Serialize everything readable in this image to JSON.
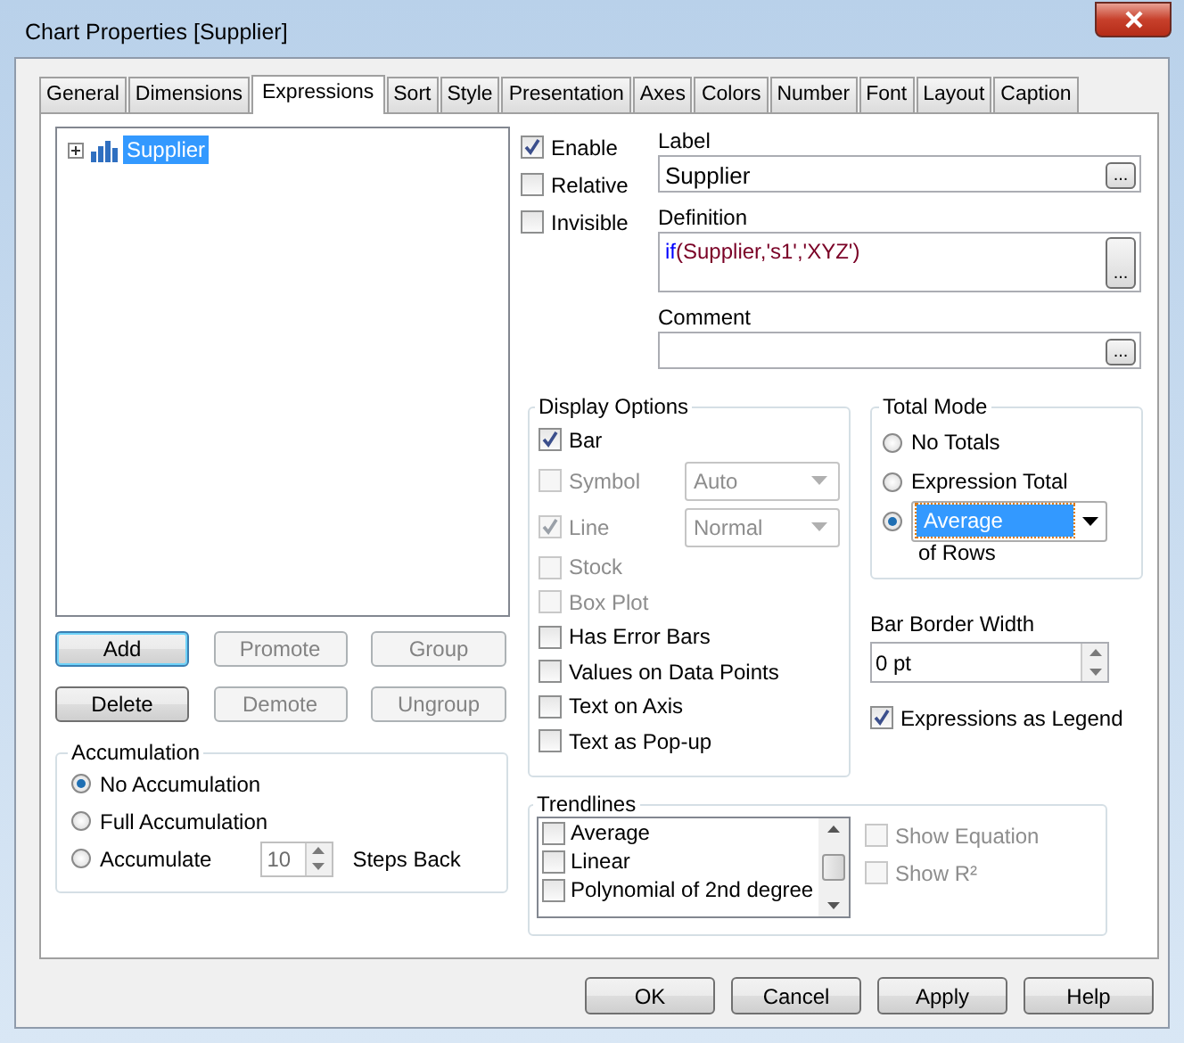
{
  "window": {
    "title": "Chart Properties [Supplier]"
  },
  "tabs": [
    {
      "label": "General",
      "selected": false
    },
    {
      "label": "Dimensions",
      "selected": false
    },
    {
      "label": "Expressions",
      "selected": true
    },
    {
      "label": "Sort",
      "selected": false
    },
    {
      "label": "Style",
      "selected": false
    },
    {
      "label": "Presentation",
      "selected": false
    },
    {
      "label": "Axes",
      "selected": false
    },
    {
      "label": "Colors",
      "selected": false
    },
    {
      "label": "Number",
      "selected": false
    },
    {
      "label": "Font",
      "selected": false
    },
    {
      "label": "Layout",
      "selected": false
    },
    {
      "label": "Caption",
      "selected": false
    }
  ],
  "tree": {
    "items": [
      {
        "label": "Supplier",
        "selected": true,
        "expanded": false
      }
    ]
  },
  "expression_buttons": [
    {
      "label": "Add",
      "disabled": false,
      "default": true
    },
    {
      "label": "Promote",
      "disabled": true,
      "default": false
    },
    {
      "label": "Group",
      "disabled": true,
      "default": false
    },
    {
      "label": "Delete",
      "disabled": false,
      "default": false
    },
    {
      "label": "Demote",
      "disabled": true,
      "default": false
    },
    {
      "label": "Ungroup",
      "disabled": true,
      "default": false
    }
  ],
  "accumulation": {
    "title": "Accumulation",
    "options": [
      {
        "label": "No Accumulation",
        "selected": true
      },
      {
        "label": "Full Accumulation",
        "selected": false
      },
      {
        "label": "Accumulate",
        "selected": false
      }
    ],
    "steps": {
      "value": "10",
      "label": "Steps Back",
      "disabled": true
    }
  },
  "flags": [
    {
      "label": "Enable",
      "checked": true
    },
    {
      "label": "Relative",
      "checked": false
    },
    {
      "label": "Invisible",
      "checked": false
    }
  ],
  "fields": [
    {
      "label": "Label",
      "value": "Supplier",
      "button": "...",
      "kind": "single"
    },
    {
      "label": "Definition",
      "parts": [
        {
          "text": "if",
          "kind": "function"
        },
        {
          "text": "(Supplier,'s1','XYZ')",
          "kind": "argument"
        }
      ],
      "button": "...",
      "kind": "multi"
    },
    {
      "label": "Comment",
      "button": "...",
      "kind": "single"
    }
  ],
  "display_options": {
    "title": "Display Options",
    "items": [
      {
        "label": "Bar",
        "checked": true,
        "disabled": false,
        "kind": "checkbox"
      },
      {
        "label": "Symbol",
        "checked": false,
        "disabled": true,
        "kind": "dropdown",
        "value": "Auto"
      },
      {
        "label": "Line",
        "checked": true,
        "disabled": true,
        "kind": "dropdown",
        "value": "Normal"
      },
      {
        "label": "Stock",
        "checked": false,
        "disabled": true,
        "kind": "checkbox"
      },
      {
        "label": "Box Plot",
        "checked": false,
        "disabled": true,
        "kind": "checkbox"
      },
      {
        "label": "Has Error Bars",
        "checked": false,
        "disabled": false,
        "kind": "checkbox"
      },
      {
        "label": "Values on Data Points",
        "checked": false,
        "disabled": false,
        "kind": "checkbox"
      },
      {
        "label": "Text on Axis",
        "checked": false,
        "disabled": false,
        "kind": "checkbox"
      },
      {
        "label": "Text as Pop-up",
        "checked": false,
        "disabled": false,
        "kind": "checkbox"
      }
    ]
  },
  "total_mode": {
    "title": "Total Mode",
    "options": [
      {
        "label": "No Totals",
        "selected": false,
        "kind": "radio"
      },
      {
        "label": "Expression Total",
        "selected": false,
        "kind": "radio"
      },
      {
        "value": "Average",
        "selected": true,
        "kind": "dropdown"
      }
    ],
    "suffix": "of Rows"
  },
  "bar_border_width": {
    "label": "Bar Border Width",
    "value": "0 pt"
  },
  "expressions_as_legend": {
    "label": "Expressions as Legend",
    "checked": true
  },
  "trendlines": {
    "title": "Trendlines",
    "items": [
      {
        "label": "Average",
        "checked": false
      },
      {
        "label": "Linear",
        "checked": false
      },
      {
        "label": "Polynomial of 2nd degree",
        "checked": false
      }
    ],
    "options": [
      {
        "label": "Show Equation",
        "checked": false,
        "disabled": true
      },
      {
        "label": "Show R²",
        "checked": false,
        "disabled": true
      }
    ]
  },
  "dialog_buttons": [
    {
      "label": "OK"
    },
    {
      "label": "Cancel"
    },
    {
      "label": "Apply"
    },
    {
      "label": "Help"
    }
  ]
}
